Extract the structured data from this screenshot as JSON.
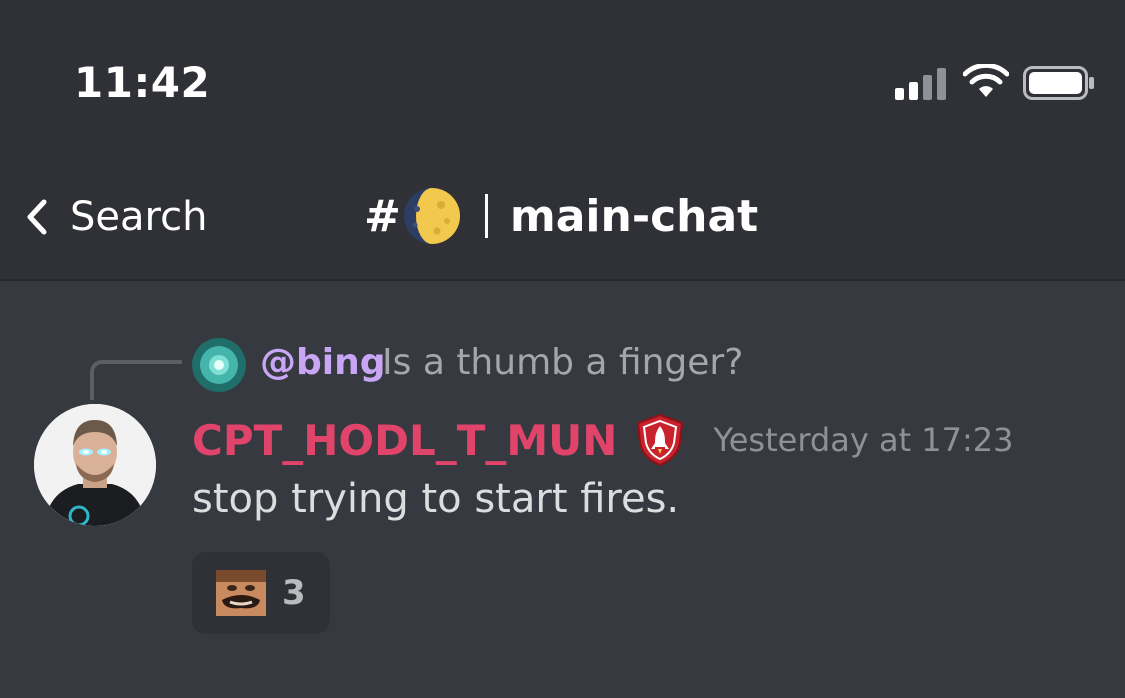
{
  "status_bar": {
    "time": "11:42"
  },
  "header": {
    "back_label": "Search",
    "channel_prefix": "#",
    "channel_name": "main-chat"
  },
  "message": {
    "reply": {
      "user": "@bing",
      "text": "Is a thumb a finger?"
    },
    "author": "CPT_HODL_T_MUN",
    "timestamp": "Yesterday at 17:23",
    "text": "stop trying to start fires.",
    "reactions": [
      {
        "emoji": "custom-face-emoji",
        "count": "3"
      }
    ]
  },
  "colors": {
    "background": "#36393f",
    "header_bg": "#2f3136",
    "author": "#e0446a",
    "mention": "#c9a6f5",
    "timestamp": "#8e9297",
    "text": "#dcddde"
  },
  "icons": [
    "signal-icon",
    "wifi-icon",
    "battery-icon",
    "chevron-left-icon",
    "moon-icon",
    "role-badge-icon"
  ]
}
